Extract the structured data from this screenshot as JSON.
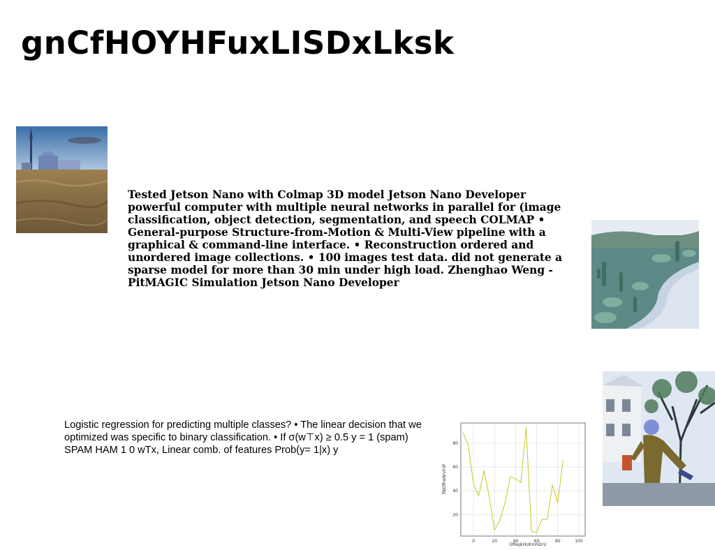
{
  "slide": {
    "title": "gnCfHOYHFuxLISDxLksk",
    "paragraph_1": "Tested Jetson Nano with Colmap 3D model Jetson Nano Developer powerful computer with multiple neural networks in parallel for (image classification, object detection, segmentation, and speech COLMAP • General-purpose Structure-from-Motion & Multi-View pipeline with a graphical & command-line interface. • Reconstruction ordered and unordered image collections. • 100 images test data. did not generate a sparse model for more than 30 min under high load. Zhenghao Weng - PitMAGIC Simulation Jetson Nano Developer",
    "paragraph_2": "Logistic regression for predicting multiple classes? • The linear decision that we optimized was specific to binary classification. • If σ(w⊤x) ≥ 0.5 y = 1 (spam) SPAM HAM 1 0 wTx, Linear comb. of features Prob(y= 1|x) y"
  },
  "images": [
    {
      "name": "photo-venice",
      "content": "church and waterfront under sky above muddy water"
    },
    {
      "name": "photo-cactus",
      "content": "desert path lined with cacti"
    },
    {
      "name": "photo-street",
      "content": "person posing on street beside house and trees"
    }
  ],
  "colors": {
    "line": "#c8c81e",
    "grid": "#d9d9d9",
    "axis": "#555555"
  },
  "chart_data": {
    "type": "line",
    "xlabel": "GfKejkHUKmhDrU",
    "ylabel": "fBjOfhwbrvFdF",
    "xticks": [
      0,
      20,
      40,
      60,
      80,
      100
    ],
    "yticks": [
      20,
      40,
      60,
      80
    ],
    "xlim": [
      -12,
      106
    ],
    "ylim": [
      2,
      97
    ],
    "grid": true,
    "x": [
      -10,
      -5,
      0,
      5,
      10,
      15,
      20,
      25,
      30,
      35,
      40,
      45,
      50,
      55,
      60,
      65,
      70,
      75,
      80,
      85,
      90,
      95,
      100
    ],
    "y": [
      89,
      78,
      46,
      36,
      57,
      35,
      7,
      15,
      30,
      52,
      50,
      47,
      93,
      6,
      5,
      16,
      16,
      45,
      30,
      66
    ]
  }
}
